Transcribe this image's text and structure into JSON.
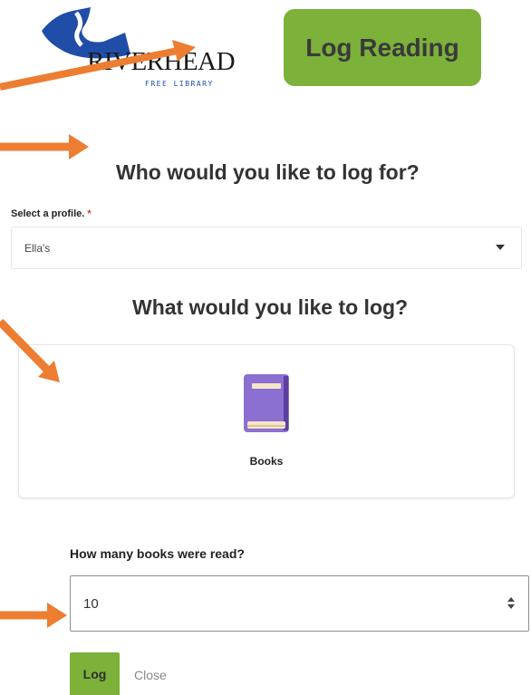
{
  "logo": {
    "name": "RIVERHEAD",
    "sub": "FREE LIBRARY"
  },
  "header": {
    "log_reading_label": "Log Reading"
  },
  "profile_section": {
    "heading": "Who would you like to log for?",
    "select_label": "Select a profile.",
    "required_mark": "*",
    "selected_value": "Ella's"
  },
  "log_section": {
    "heading": "What would you like to log?",
    "option_label": "Books"
  },
  "count_field": {
    "label": "How many books were read?",
    "value": "10"
  },
  "actions": {
    "log_label": "Log",
    "close_label": "Close"
  },
  "colors": {
    "accent_green": "#7cb13a",
    "arrow_orange": "#ed7d31",
    "logo_blue": "#1f4da8",
    "book_purple": "#8b6fd1"
  }
}
